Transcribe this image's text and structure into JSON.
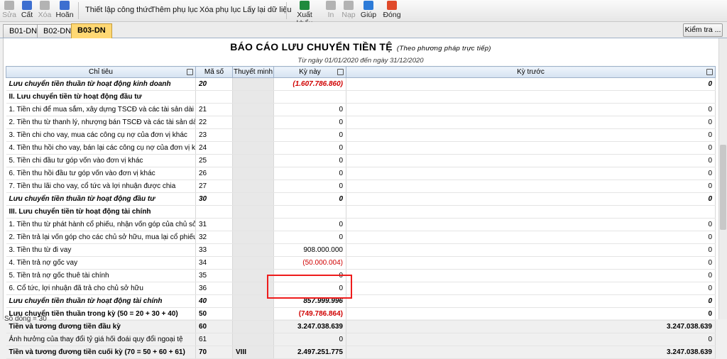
{
  "toolbar": {
    "buttons": [
      {
        "label": "Sửa",
        "icon": "edit-icon",
        "color": "#b3b3b3",
        "disabled": true
      },
      {
        "label": "Cất",
        "icon": "save-icon",
        "color": "#3d6fd0",
        "disabled": false
      },
      {
        "label": "Xóa",
        "icon": "delete-icon",
        "color": "#b3b3b3",
        "disabled": true
      },
      {
        "label": "Hoãn",
        "icon": "undo-icon",
        "color": "#3d6fd0",
        "disabled": false
      }
    ],
    "text_buttons": [
      "Thiết lập công thức",
      "Thêm phụ lục",
      "Xóa phụ lục",
      "Lấy lại dữ liệu"
    ],
    "right_buttons": [
      {
        "label": "Xuất khẩu",
        "icon": "excel-export-icon",
        "color": "#1f8a3d",
        "disabled": false
      },
      {
        "label": "In",
        "icon": "print-icon",
        "color": "#b3b3b3",
        "disabled": true
      },
      {
        "label": "Nạp",
        "icon": "refresh-icon",
        "color": "#b3b3b3",
        "disabled": true
      },
      {
        "label": "Giúp",
        "icon": "help-icon",
        "color": "#2d7bd8",
        "disabled": false
      },
      {
        "label": "Đóng",
        "icon": "close-icon",
        "color": "#e04a2b",
        "disabled": false
      }
    ]
  },
  "tabs": [
    "B01-DN",
    "B02-DN",
    "B03-DN"
  ],
  "active_tab": 2,
  "check_button": "Kiểm tra ...",
  "report": {
    "title": "BÁO CÁO LƯU CHUYỂN TIỀN TỆ",
    "subtitle": "(Theo phương pháp trực tiếp)",
    "period": "Từ ngày 01/01/2020 đến ngày 31/12/2020"
  },
  "columns": [
    "Chỉ tiêu",
    "Mã số",
    "Thuyết minh",
    "Kỳ này",
    "Kỳ trước"
  ],
  "rows": [
    {
      "label": "Lưu chuyển tiền thuần từ hoạt động kinh doanh",
      "code": "20",
      "note": "",
      "current": "(1.607.786.860)",
      "previous": "0",
      "style": "bi",
      "neg": true
    },
    {
      "label": "II. Lưu chuyển tiền từ hoạt động đầu tư",
      "code": "",
      "note": "",
      "current": "",
      "previous": "",
      "style": "b",
      "neg": false
    },
    {
      "label": "1. Tiền chi để mua sắm, xây dựng TSCĐ và các tài sản dài hạn khác",
      "code": "21",
      "note": "",
      "current": "0",
      "previous": "0",
      "style": "",
      "neg": false
    },
    {
      "label": "2. Tiền thu từ thanh lý, nhượng bán TSCĐ và các tài sản dài hạn khác",
      "code": "22",
      "note": "",
      "current": "0",
      "previous": "0",
      "style": "",
      "neg": false
    },
    {
      "label": "3. Tiền chi cho vay, mua các công cụ nợ của đơn vị khác",
      "code": "23",
      "note": "",
      "current": "0",
      "previous": "0",
      "style": "",
      "neg": false
    },
    {
      "label": "4. Tiền thu hồi cho vay, bán lại các công cụ nợ của đơn vị khác",
      "code": "24",
      "note": "",
      "current": "0",
      "previous": "0",
      "style": "",
      "neg": false
    },
    {
      "label": "5. Tiền chi đầu tư góp vốn vào đơn vị khác",
      "code": "25",
      "note": "",
      "current": "0",
      "previous": "0",
      "style": "",
      "neg": false
    },
    {
      "label": "6. Tiền thu hồi đầu tư góp vốn vào đơn vị khác",
      "code": "26",
      "note": "",
      "current": "0",
      "previous": "0",
      "style": "",
      "neg": false
    },
    {
      "label": "7. Tiền thu lãi cho vay, cổ tức và lợi nhuận được chia",
      "code": "27",
      "note": "",
      "current": "0",
      "previous": "0",
      "style": "",
      "neg": false
    },
    {
      "label": "Lưu chuyển tiền thuần từ hoạt động đầu tư",
      "code": "30",
      "note": "",
      "current": "0",
      "previous": "0",
      "style": "bi",
      "neg": false
    },
    {
      "label": "III. Lưu chuyển tiền từ hoạt động tài chính",
      "code": "",
      "note": "",
      "current": "",
      "previous": "",
      "style": "b",
      "neg": false
    },
    {
      "label": "1. Tiền thu từ phát hành cổ phiếu, nhận vốn góp của chủ sở hữu",
      "code": "31",
      "note": "",
      "current": "0",
      "previous": "0",
      "style": "",
      "neg": false
    },
    {
      "label": "2. Tiền trả lại vốn góp cho các chủ sở hữu, mua lại cổ phiếu của doanh nghiệp",
      "code": "32",
      "note": "",
      "current": "0",
      "previous": "0",
      "style": "",
      "neg": false
    },
    {
      "label": "3. Tiền thu từ đi vay",
      "code": "33",
      "note": "",
      "current": "908.000.000",
      "previous": "0",
      "style": "",
      "neg": false
    },
    {
      "label": "4. Tiền trả nợ gốc vay",
      "code": "34",
      "note": "",
      "current": "(50.000.004)",
      "previous": "0",
      "style": "",
      "neg": true
    },
    {
      "label": "5. Tiền trả nợ gốc thuê tài chính",
      "code": "35",
      "note": "",
      "current": "0",
      "previous": "0",
      "style": "",
      "neg": false
    },
    {
      "label": "6. Cổ tức, lợi nhuận đã trả cho chủ sở hữu",
      "code": "36",
      "note": "",
      "current": "0",
      "previous": "0",
      "style": "",
      "neg": false
    },
    {
      "label": "Lưu chuyển tiền thuần từ hoạt động tài chính",
      "code": "40",
      "note": "",
      "current": "857.999.996",
      "previous": "0",
      "style": "bi",
      "neg": false
    },
    {
      "label": "Lưu chuyển tiền thuần trong kỳ (50 = 20 + 30 + 40)",
      "code": "50",
      "note": "",
      "current": "(749.786.864)",
      "previous": "0",
      "style": "b",
      "neg": true
    },
    {
      "label": "Tiền và tương đương tiền đầu kỳ",
      "code": "60",
      "note": "",
      "current": "3.247.038.639",
      "previous": "3.247.038.639",
      "style": "b",
      "neg": false
    },
    {
      "label": "Ảnh hưởng của thay đổi tỷ giá hối đoái quy đổi ngoại tệ",
      "code": "61",
      "note": "",
      "current": "0",
      "previous": "0",
      "style": "",
      "neg": false
    },
    {
      "label": "Tiền và tương đương tiền cuối kỳ (70 = 50 + 60 + 61)",
      "code": "70",
      "note": "VIII",
      "current": "2.497.251.775",
      "previous": "3.247.038.639",
      "style": "b",
      "neg": false
    }
  ],
  "status_text": "Số dòng = 30",
  "highlight_color": "#ee1c1c"
}
